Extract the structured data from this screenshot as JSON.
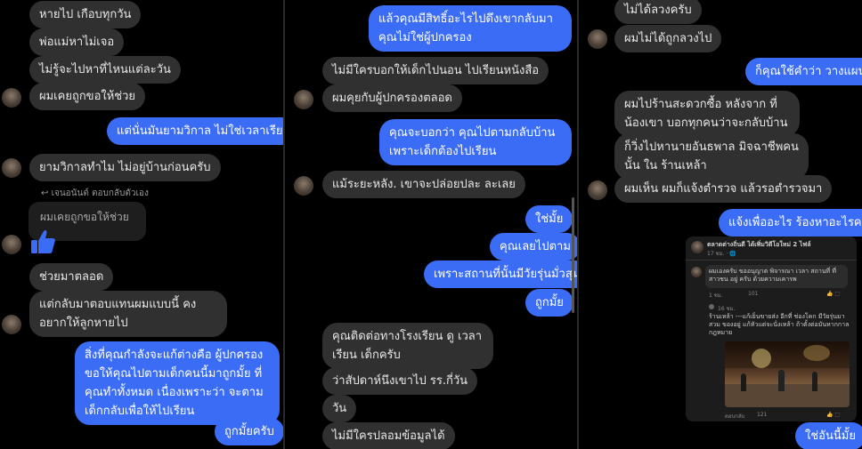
{
  "panel1": {
    "m1": "หายไป เกือบทุกวัน",
    "m2": "พ่อแม่หาไม่เจอ",
    "m3": "ไม่รู้จะไปหาที่ไหนแต่ละวัน",
    "m4": "ผมเคยถูกขอให้ช่วย",
    "m5": "แต่นั่นมันยามวิกาล ไม่ใช่เวลาเรียน",
    "m6": "ยามวิกาลทำไม ไม่อยู่บ้านก่อนครับ",
    "reply_note": "เจนอนันต์ ตอบกลับตัวเอง",
    "quoted": "ผมเคยถูกขอให้ช่วย",
    "m7": "ช่วยมาตลอด",
    "m8": "แต่กลับมาตอบแทนผมแบบนี้ คงอยากให้ลูกหายไป",
    "m9": "สิ่งที่คุณกำลังจะแก้ต่างคือ ผู้ปกครองขอให้คุณไปตามเด็กคนนี้มาถูกมั้ย ที่คุณทำทั้งหมด เนื่องเพราะว่า จะตามเด็กกลับเพื่อให้ไปเรียน",
    "m10": "ถูกมั้ยครับ"
  },
  "panel2": {
    "m1": "แล้วคุณมีสิทธิ์อะไรไปดึงเขากลับมา คุณไม่ใช่ผู้ปกครอง",
    "m2": "ไม่มีใครบอกให้เด็กไปนอน ไปเรียนหนังสือ",
    "m3": "ผมคุยกับผู้ปกครองตลอด",
    "m4": "คุณจะบอกว่า คุณไปตามกลับบ้านเพราะเด็กต้องไปเรียน",
    "m5": "แม้ระยะหลัง. เขาจะปล่อยปละ ละเลย",
    "m6": "ใช่มั้ย",
    "m7": "คุณเลยไปตาม",
    "m8": "เพราะสถานที่นั้นมีวัยรุ่นมั่วสุม",
    "m9": "ถูกมั้ย",
    "m10": "คุณติดต่อทางโรงเรียน ดู เวลาเรียน เด็กครับ",
    "m11": "ว่าสัปดาห์นึงเขาไป รร.กี่วัน",
    "m12": "วัน",
    "m13": "ไม่มีใครปลอมข้อมูลได้"
  },
  "panel3": {
    "m1": "ไม่ได้ลวงครับ",
    "m2": "ผมไม่ได้ถูกลวงไป",
    "m3": "ก็คุณใช้คำว่า วางแผน",
    "m4": "ผมไปร้านสะดวกซื้อ หลังจาก ที่น้องเขา บอกทุกคนว่าจะกลับบ้าน",
    "m5": "ก็วิ่งไปหานายอันธพาล มิจฉาชีพคนนั้น ใน ร้านเหล้า",
    "m6": "ผมเห็น ผมก็แจ้งตำรวจ แล้วรอตำรวจมา",
    "m7": "แจ้งเพื่ออะไร ร้องหาอะไรครับ",
    "m8": "ใช่อันนี้มั้ย",
    "card": {
      "header": "ตลาดต่างถิ่นดี ได้เพิ่มวิดีโอใหม่ 2 ไฟล์",
      "header_sub": "17 ชม. · 🌐",
      "c1": "ผมเองครับ ขออนุญาต พิจารณา เวลา สถานที่ ที่สาวชน อยู่ ครับ ด้วยความเคารพ",
      "c1_time": "1 ชม.",
      "c1_count": "101",
      "c2_time": "16 ชม.",
      "c2": "ร้านเหล้า ---แก้เย็นขายส่ง อีกที่ ช่องโคก มีวัยรุ่นมาสวม ของอยู่ แก้หัวแต่จะนั่งเหล้า ถ้าตั้งต่อมันหากกาล กฎหมาย",
      "c3_time": "ตอบกลับ",
      "c3_count": "121"
    }
  },
  "colors": {
    "outgoing": "#3b6cf5",
    "incoming": "#303030",
    "background": "#000000"
  }
}
